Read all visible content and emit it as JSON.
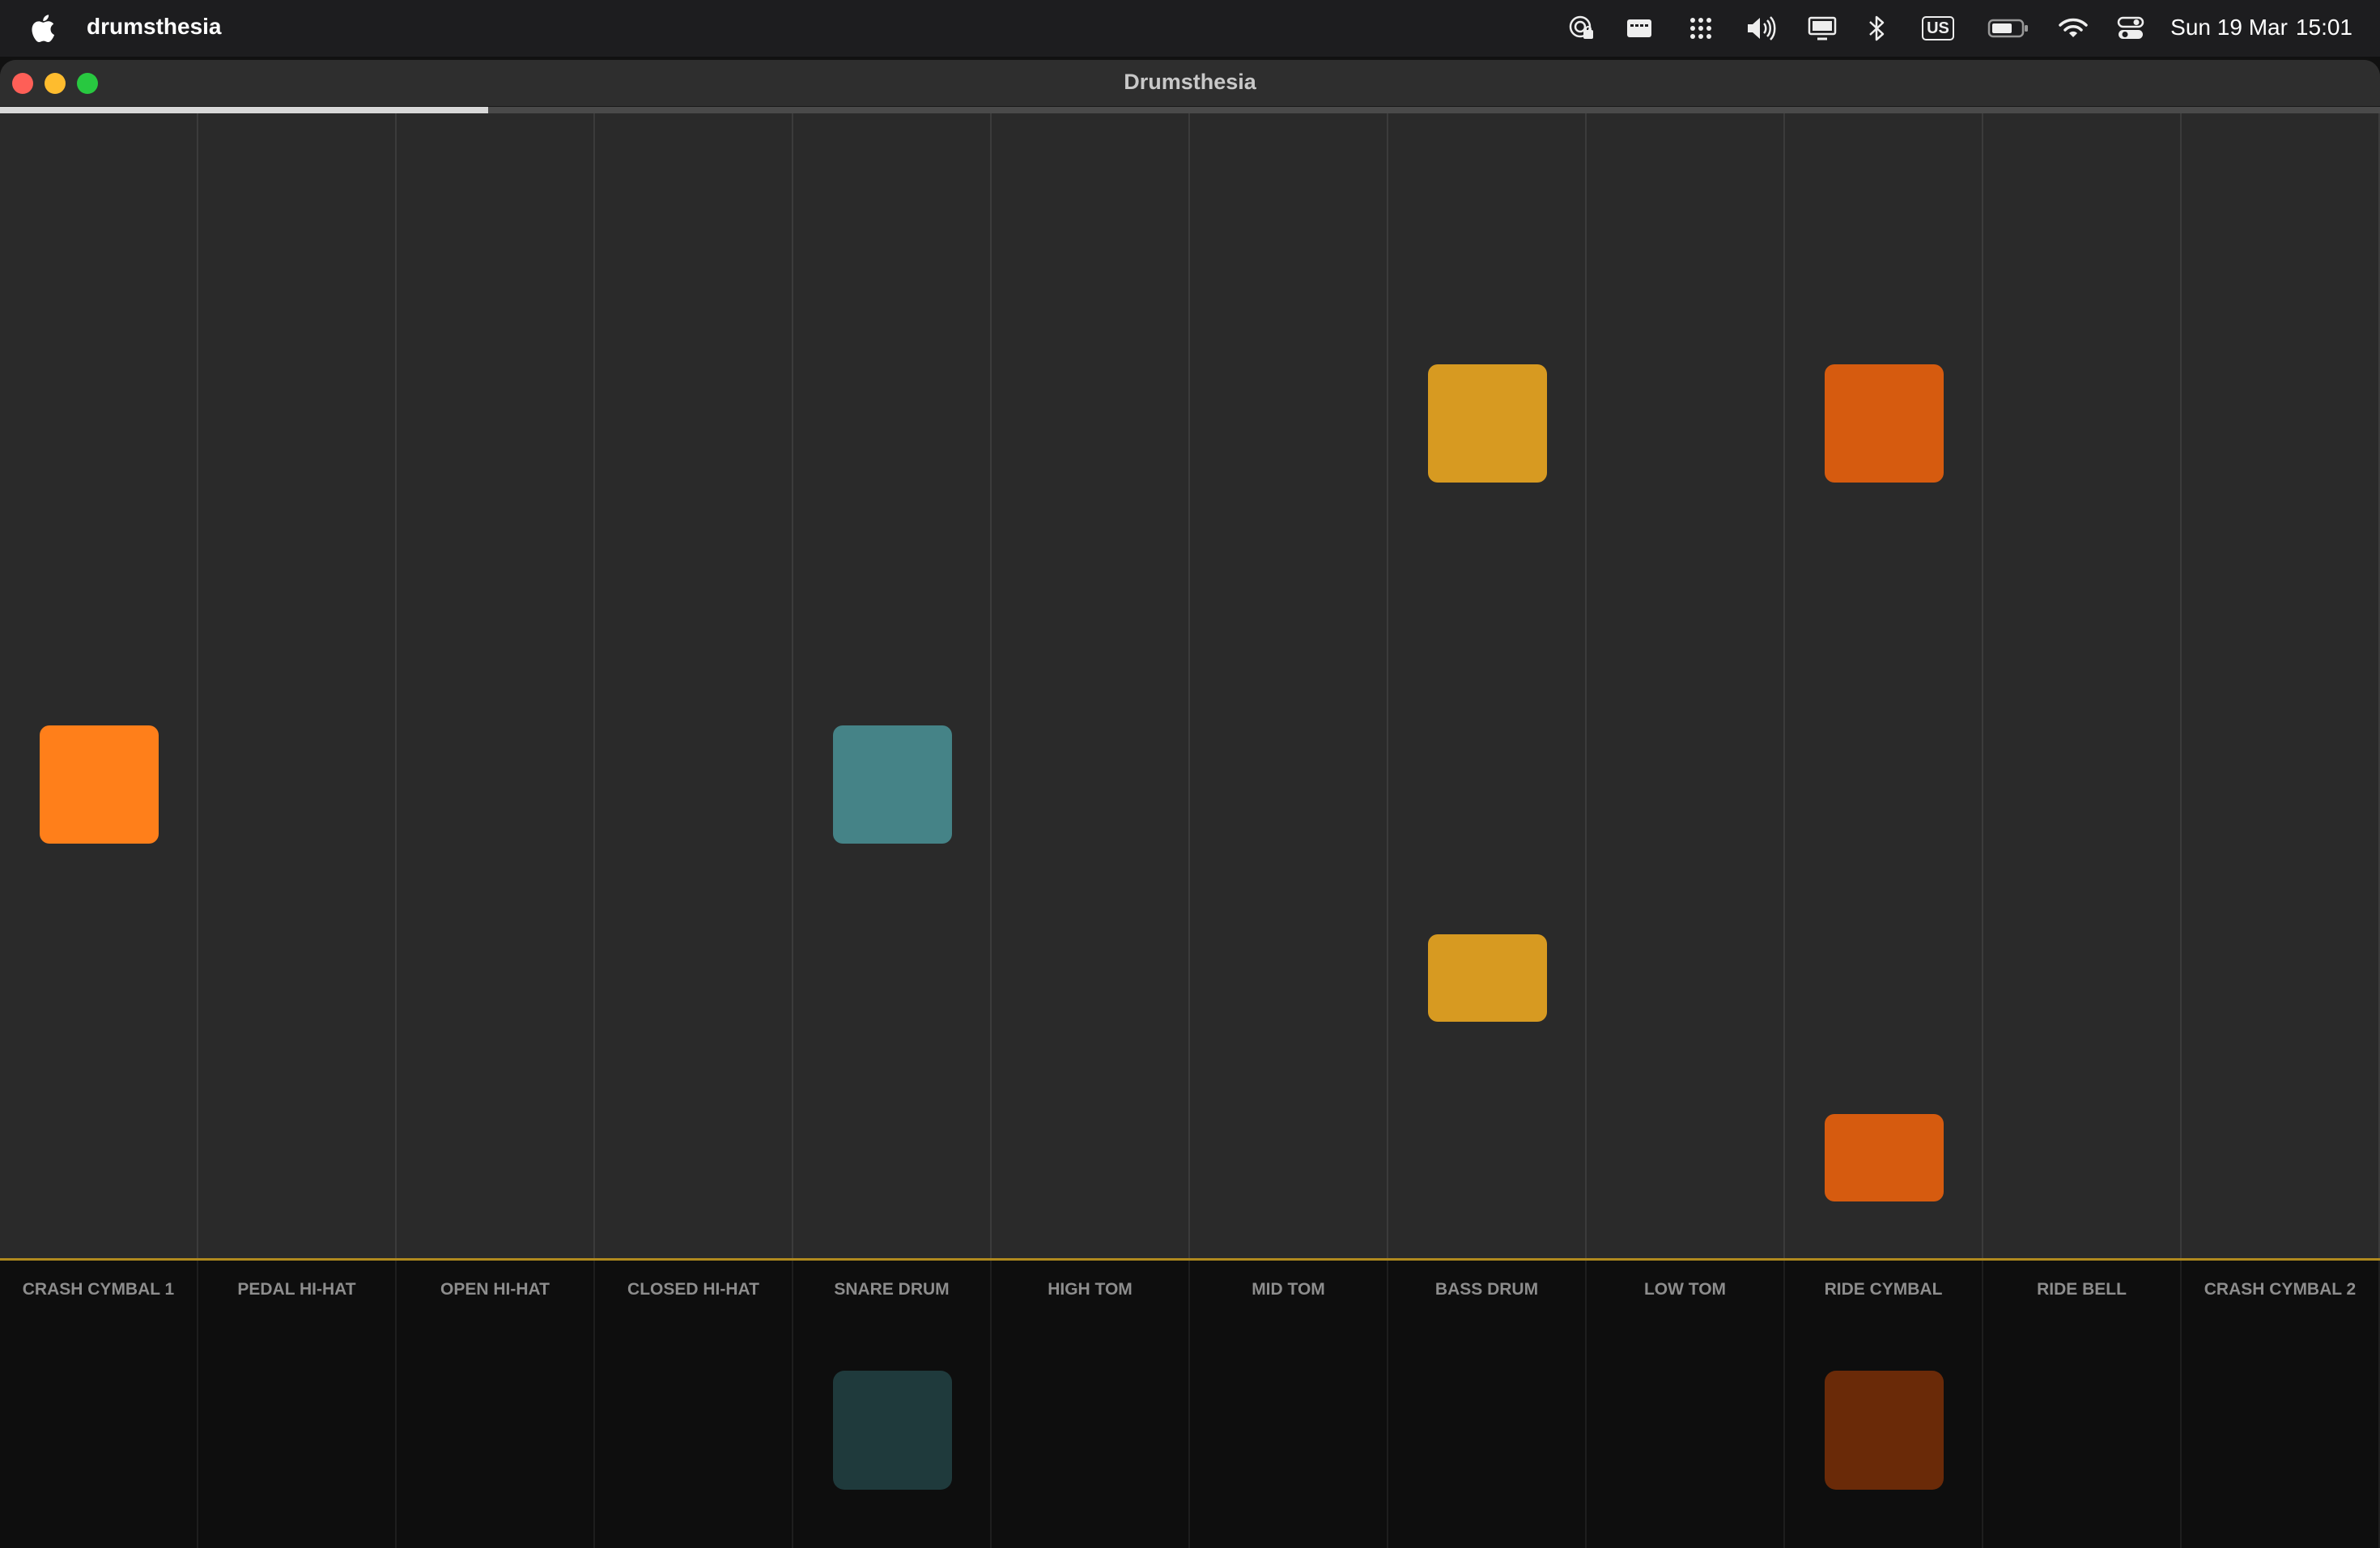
{
  "menubar": {
    "app_name": "drumsthesia",
    "keyboard_layout": "US",
    "clock_date": "Sun 19 Mar",
    "clock_time": "15:01",
    "icons": [
      "apple-icon",
      "airdrop-lock-icon",
      "display-icon",
      "launchpad-icon",
      "volume-icon",
      "screen-mirroring-icon",
      "bluetooth-icon",
      "keyboard-layout-icon",
      "battery-icon",
      "wifi-icon",
      "control-center-icon"
    ]
  },
  "window": {
    "title": "Drumsthesia",
    "playback_progress": 0.205
  },
  "lanes": [
    {
      "label": "CRASH CYMBAL 1",
      "color": "#ff7f1a",
      "dim_color": "#5c2e0a"
    },
    {
      "label": "PEDAL HI-HAT",
      "color": "#888888",
      "dim_color": "#222222"
    },
    {
      "label": "OPEN HI-HAT",
      "color": "#888888",
      "dim_color": "#222222"
    },
    {
      "label": "CLOSED HI-HAT",
      "color": "#888888",
      "dim_color": "#222222"
    },
    {
      "label": "SNARE DRUM",
      "color": "#458387",
      "dim_color": "#1f3a3c"
    },
    {
      "label": "HIGH TOM",
      "color": "#888888",
      "dim_color": "#222222"
    },
    {
      "label": "MID TOM",
      "color": "#888888",
      "dim_color": "#222222"
    },
    {
      "label": "BASS DRUM",
      "color": "#d79a21",
      "dim_color": "#4d3a0c"
    },
    {
      "label": "LOW TOM",
      "color": "#888888",
      "dim_color": "#222222"
    },
    {
      "label": "RIDE CYMBAL",
      "color": "#d65b0f",
      "dim_color": "#6a2a08"
    },
    {
      "label": "RIDE BELL",
      "color": "#888888",
      "dim_color": "#222222"
    },
    {
      "label": "CRASH CYMBAL 2",
      "color": "#888888",
      "dim_color": "#222222"
    }
  ],
  "active_pads": [
    "SNARE DRUM",
    "RIDE CYMBAL"
  ]
}
